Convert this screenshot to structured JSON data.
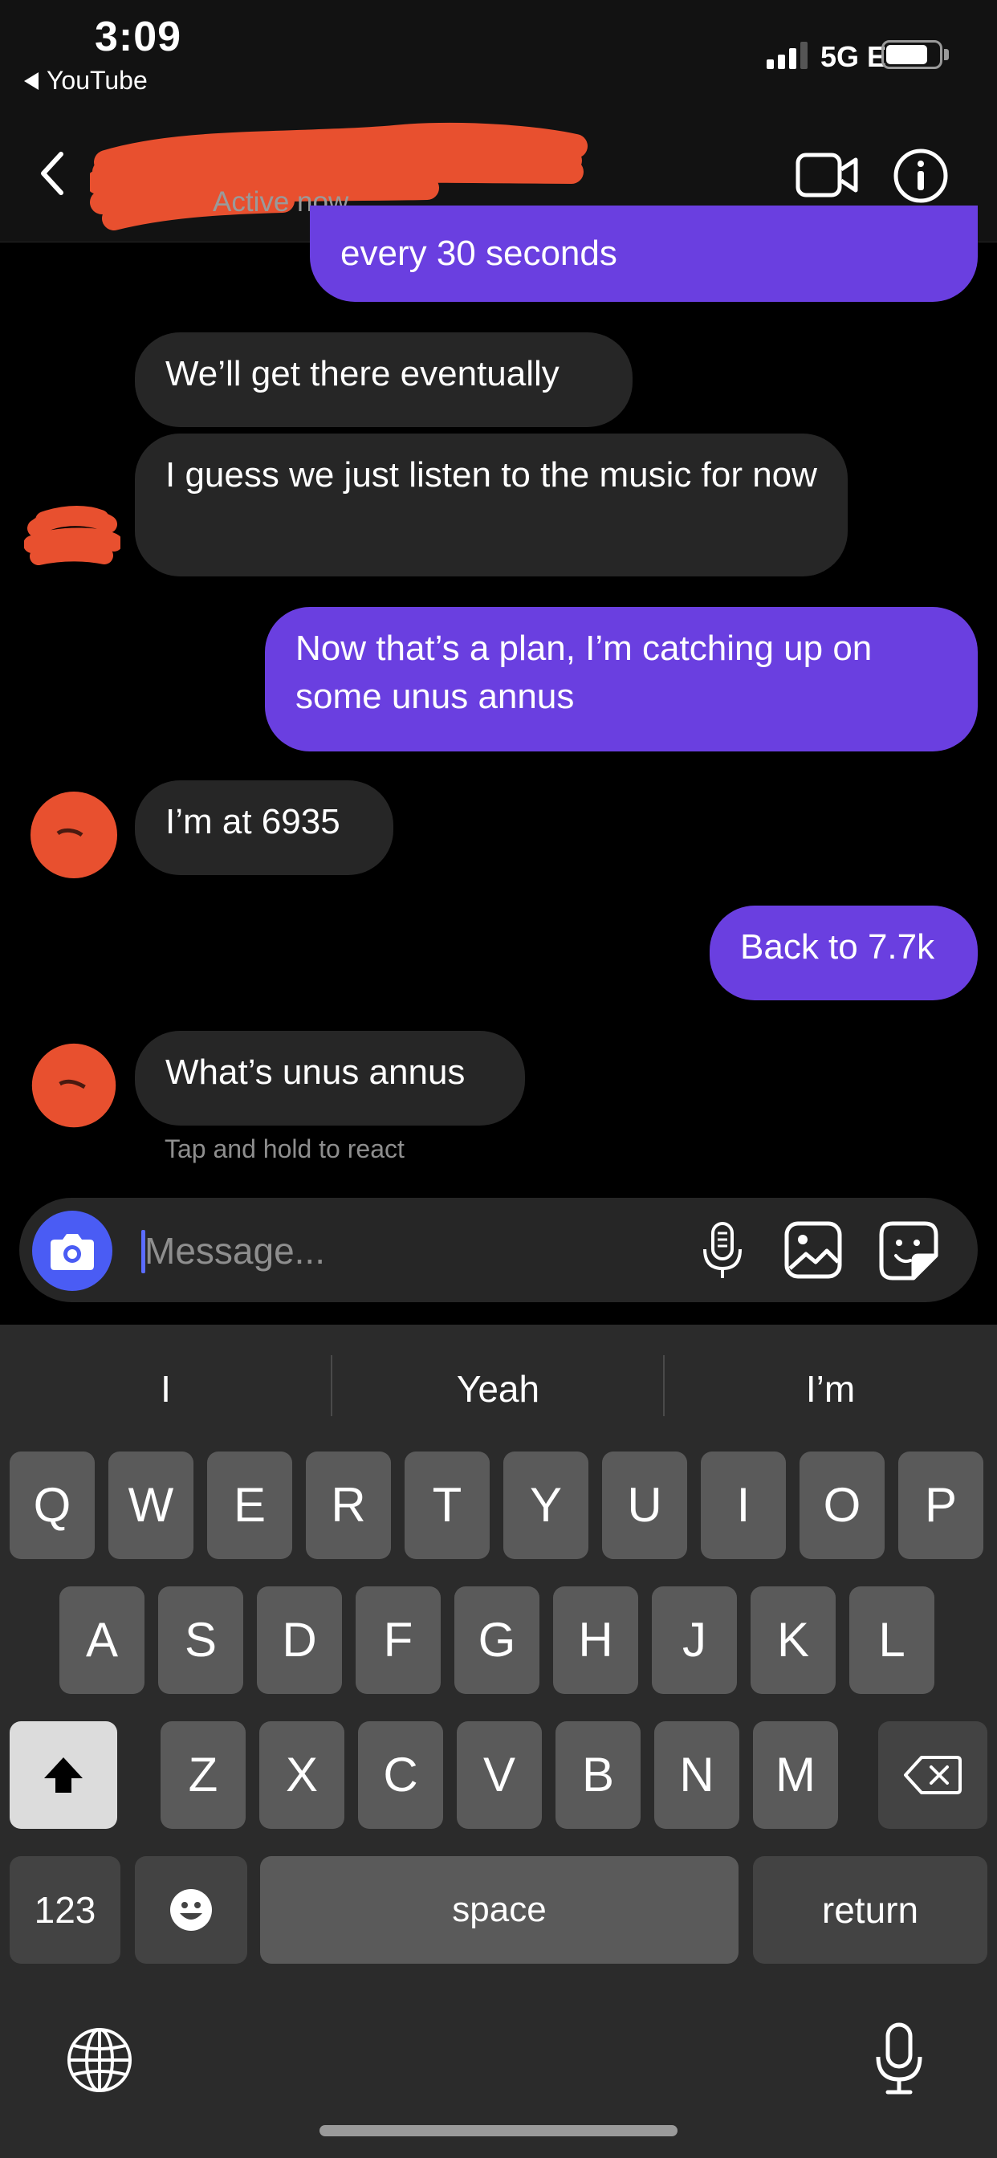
{
  "status_bar": {
    "time": "3:09",
    "back_app": "YouTube",
    "network": "5G E"
  },
  "header": {
    "subtitle": "Active now"
  },
  "messages": [
    {
      "side": "out",
      "text": "every 30 seconds"
    },
    {
      "side": "in",
      "text": "We’ll get there eventually"
    },
    {
      "side": "in",
      "text": "I guess we just listen to the music for now"
    },
    {
      "side": "out",
      "text": "Now that’s a plan, I’m catching up on some unus annus"
    },
    {
      "side": "in",
      "text": "I’m at 6935"
    },
    {
      "side": "out",
      "text": "Back to 7.7k"
    },
    {
      "side": "in",
      "text": "What’s unus annus"
    }
  ],
  "reaction_hint": "Tap and hold to react",
  "composer": {
    "placeholder": "Message..."
  },
  "keyboard": {
    "suggestions": [
      "I",
      "Yeah",
      "I’m"
    ],
    "row1": [
      "Q",
      "W",
      "E",
      "R",
      "T",
      "Y",
      "U",
      "I",
      "O",
      "P"
    ],
    "row2": [
      "A",
      "S",
      "D",
      "F",
      "G",
      "H",
      "J",
      "K",
      "L"
    ],
    "row3": [
      "Z",
      "X",
      "C",
      "V",
      "B",
      "N",
      "M"
    ],
    "numbers_label": "123",
    "space_label": "space",
    "return_label": "return"
  },
  "colors": {
    "outgoing": "#6a3fe0",
    "incoming": "#262626",
    "camera": "#4a5cf4",
    "redaction": "#e8502f"
  }
}
